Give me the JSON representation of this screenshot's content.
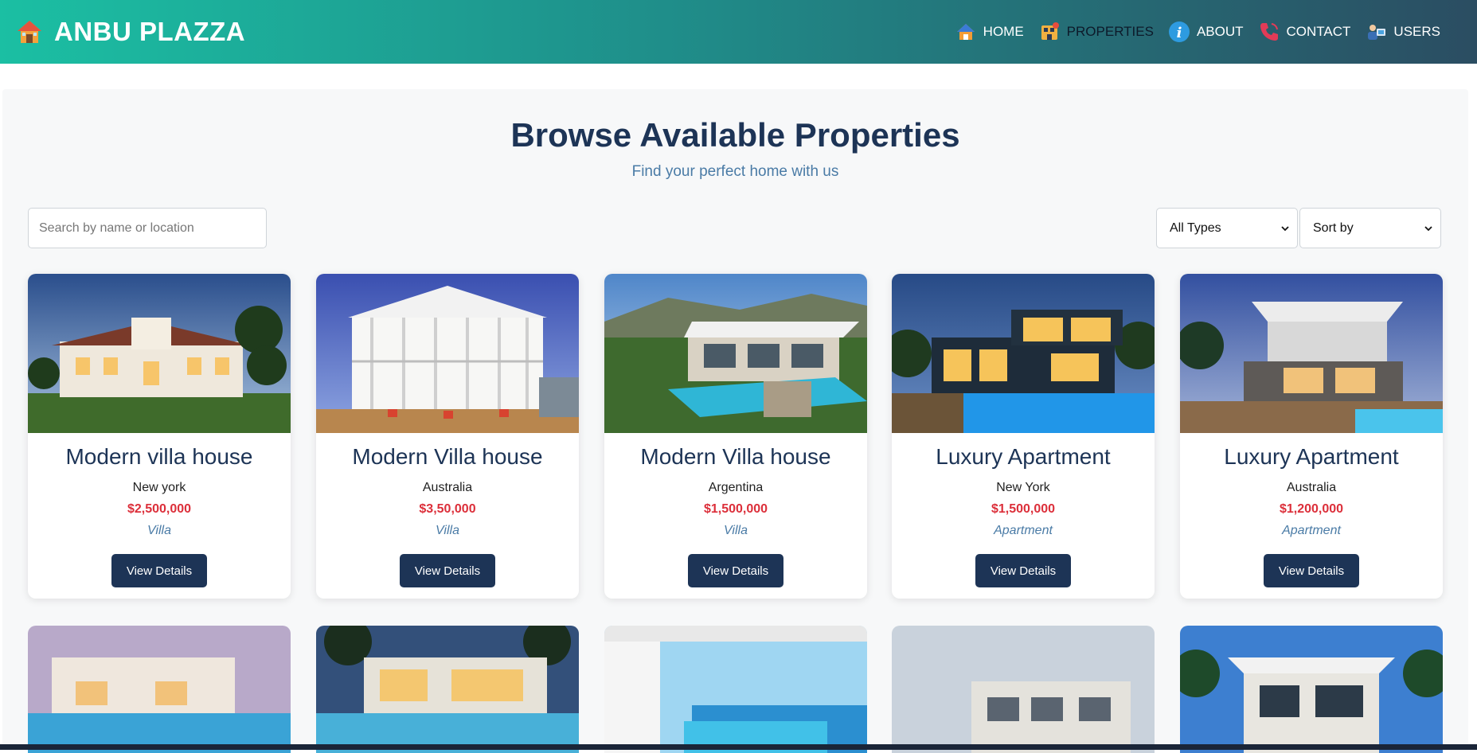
{
  "brand": {
    "title": "ANBU PLAZZA"
  },
  "nav": [
    {
      "label": "HOME",
      "icon": "home-icon",
      "active": false
    },
    {
      "label": "PROPERTIES",
      "icon": "properties-icon",
      "active": true
    },
    {
      "label": "ABOUT",
      "icon": "info-icon",
      "active": false
    },
    {
      "label": "CONTACT",
      "icon": "phone-icon",
      "active": false
    },
    {
      "label": "USERS",
      "icon": "users-icon",
      "active": false
    }
  ],
  "page": {
    "heading": "Browse Available Properties",
    "subheading": "Find your perfect home with us"
  },
  "filters": {
    "search_placeholder": "Search by name or location",
    "type_selected": "All Types",
    "sort_selected": "Sort by"
  },
  "properties": [
    {
      "name": "Modern villa house",
      "location": "New york",
      "price": "$2,500,000",
      "type": "Villa",
      "button": "View Details"
    },
    {
      "name": "Modern Villa house",
      "location": "Australia",
      "price": "$3,50,000",
      "type": "Villa",
      "button": "View Details"
    },
    {
      "name": "Modern Villa house",
      "location": "Argentina",
      "price": "$1,500,000",
      "type": "Villa",
      "button": "View Details"
    },
    {
      "name": "Luxury Apartment",
      "location": "New York",
      "price": "$1,500,000",
      "type": "Apartment",
      "button": "View Details"
    },
    {
      "name": "Luxury Apartment",
      "location": "Australia",
      "price": "$1,200,000",
      "type": "Apartment",
      "button": "View Details"
    }
  ],
  "colors": {
    "accent": "#1d3456",
    "price": "#dc2f3a",
    "muted": "#4a7ba6"
  }
}
